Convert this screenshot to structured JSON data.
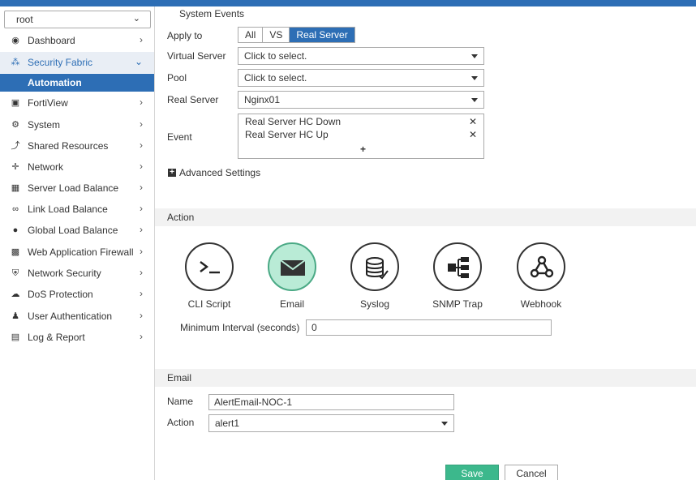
{
  "sidebar": {
    "vdom": "root",
    "items": [
      {
        "label": "Dashboard",
        "icon": "dashboard-icon"
      },
      {
        "label": "Security Fabric",
        "icon": "security-fabric-icon"
      },
      {
        "label": "Automation",
        "icon": ""
      },
      {
        "label": "FortiView",
        "icon": "fortiview-icon"
      },
      {
        "label": "System",
        "icon": "gear-icon"
      },
      {
        "label": "Shared Resources",
        "icon": "share-icon"
      },
      {
        "label": "Network",
        "icon": "network-icon"
      },
      {
        "label": "Server Load Balance",
        "icon": "server-lb-icon"
      },
      {
        "label": "Link Load Balance",
        "icon": "link-icon"
      },
      {
        "label": "Global Load Balance",
        "icon": "globe-icon"
      },
      {
        "label": "Web Application Firewall",
        "icon": "waf-icon"
      },
      {
        "label": "Network Security",
        "icon": "shield-icon"
      },
      {
        "label": "DoS Protection",
        "icon": "cloud-icon"
      },
      {
        "label": "User Authentication",
        "icon": "user-icon"
      },
      {
        "label": "Log & Report",
        "icon": "chart-icon"
      }
    ]
  },
  "form": {
    "section_title": "System Events",
    "apply_to": {
      "label": "Apply to",
      "options": [
        "All",
        "VS",
        "Real Server"
      ],
      "selected": "Real Server"
    },
    "virtual_server": {
      "label": "Virtual Server",
      "value": "Click to select."
    },
    "pool": {
      "label": "Pool",
      "value": "Click to select."
    },
    "real_server": {
      "label": "Real Server",
      "value": "Nginx01"
    },
    "event": {
      "label": "Event",
      "values": [
        "Real Server HC Down",
        "Real Server HC Up"
      ],
      "add": "+"
    },
    "advanced": "Advanced Settings"
  },
  "action": {
    "title": "Action",
    "items": [
      {
        "label": "CLI Script",
        "icon": "terminal-icon",
        "selected": false
      },
      {
        "label": "Email",
        "icon": "envelope-icon",
        "selected": true
      },
      {
        "label": "Syslog",
        "icon": "database-icon",
        "selected": false
      },
      {
        "label": "SNMP Trap",
        "icon": "snmp-icon",
        "selected": false
      },
      {
        "label": "Webhook",
        "icon": "webhook-icon",
        "selected": false
      }
    ],
    "min_interval": {
      "label": "Minimum Interval (seconds)",
      "value": "0"
    }
  },
  "email": {
    "title": "Email",
    "name": {
      "label": "Name",
      "value": "AlertEmail-NOC-1"
    },
    "action": {
      "label": "Action",
      "value": "alert1"
    }
  },
  "buttons": {
    "save": "Save",
    "cancel": "Cancel"
  },
  "colors": {
    "accent": "#2d6eb5",
    "save": "#3cb88c",
    "selected_action": "#b9ebd6"
  }
}
